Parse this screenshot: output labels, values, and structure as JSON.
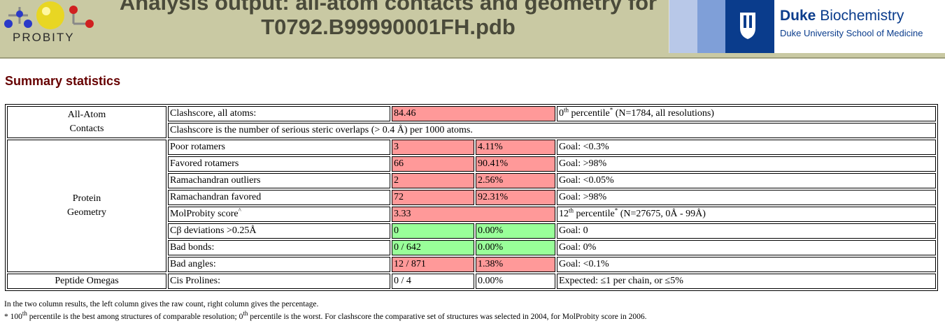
{
  "header": {
    "logo_text": "PROBITY",
    "title_line1": "Analysis output: all-atom contacts and geometry for",
    "title_line2": "T0792.B99990001FH.pdb",
    "duke_name_bold": "Duke",
    "duke_name_rest": "Biochemistry",
    "duke_sub": "Duke University School of Medicine"
  },
  "section_title": "Summary statistics",
  "table": {
    "cat_allatom_1": "All-Atom",
    "cat_allatom_2": "Contacts",
    "clashscore_label": "Clashscore, all atoms:",
    "clashscore_value": "84.46",
    "clashscore_pct_num": "0",
    "clashscore_pct_sup": "th",
    "clashscore_pct_text": " percentile",
    "clashscore_pct_tail": " (N=1784, all resolutions)",
    "clashscore_desc": "Clashscore is the number of serious steric overlaps (> 0.4 Å) per 1000 atoms.",
    "cat_protein_1": "Protein",
    "cat_protein_2": "Geometry",
    "rows": [
      {
        "label": "Poor rotamers",
        "count": "3",
        "pct": "4.11%",
        "goal": "Goal: <0.3%"
      },
      {
        "label": "Favored rotamers",
        "count": "66",
        "pct": "90.41%",
        "goal": "Goal: >98%"
      },
      {
        "label": "Ramachandran outliers",
        "count": "2",
        "pct": "2.56%",
        "goal": "Goal: <0.05%"
      },
      {
        "label": "Ramachandran favored",
        "count": "72",
        "pct": "92.31%",
        "goal": "Goal: >98%"
      }
    ],
    "molprobity_label": "MolProbity score",
    "molprobity_value": "3.33",
    "molprobity_pct_num": "12",
    "molprobity_pct_sup": "th",
    "molprobity_pct_text": " percentile",
    "molprobity_pct_tail": " (N=27675, 0Å - 99Å)",
    "rows2": [
      {
        "label": "Cβ deviations >0.25Å",
        "count": "0",
        "pct": "0.00%",
        "goal": "Goal: 0"
      },
      {
        "label": "Bad bonds:",
        "count": "0 / 642",
        "pct": "0.00%",
        "goal": "Goal: 0%"
      },
      {
        "label": "Bad angles:",
        "count": "12 / 871",
        "pct": "1.38%",
        "goal": "Goal: <0.1%"
      }
    ],
    "cat_peptide": "Peptide Omegas",
    "cis_label": "Cis Prolines:",
    "cis_count": "0 / 4",
    "cis_pct": "0.00%",
    "cis_goal": "Expected: ≤1 per chain, or ≤5%"
  },
  "notes": {
    "line1": "In the two column results, the left column gives the raw count, right column gives the percentage.",
    "line2_a": "* 100",
    "line2_b": " percentile is the best among structures of comparable resolution; 0",
    "line2_c": " percentile is the worst. For clashscore the comparative set of structures was selected in 2004, for MolProbity score in 2006.",
    "sup_th": "th"
  },
  "colors": {
    "bad": "#ff9999",
    "good": "#99ff99",
    "header_bg": "#c9c9a3",
    "section_title": "#660000",
    "duke_blue": "#0a3c8c"
  }
}
